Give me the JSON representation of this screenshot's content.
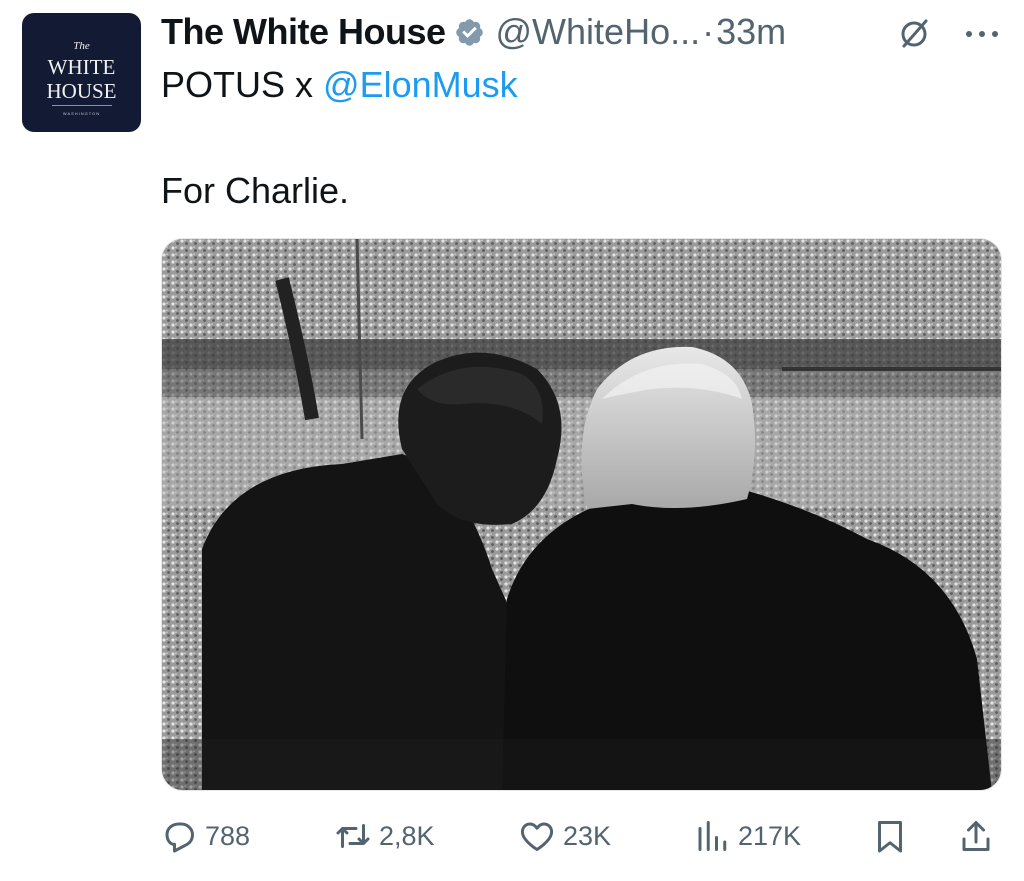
{
  "account": {
    "display_name": "The White House",
    "handle": "@WhiteHo...",
    "separator": "·",
    "timestamp": "33m",
    "verified_icon": "verified-badge-icon",
    "avatar_text": {
      "the": "The",
      "line1": "WHITE",
      "line2": "HOUSE",
      "sub": "WASHINGTON"
    }
  },
  "post": {
    "context_prefix": "POTUS x ",
    "context_mention": "@ElonMusk",
    "text": "For Charlie."
  },
  "actions": {
    "replies": "788",
    "reposts": "2,8K",
    "likes": "23K",
    "views": "217K"
  },
  "icons": {
    "grok": "grok-icon",
    "more": "more-icon",
    "reply": "reply-icon",
    "repost": "repost-icon",
    "like": "heart-icon",
    "views": "analytics-icon",
    "bookmark": "bookmark-icon",
    "share": "share-icon"
  },
  "colors": {
    "text": "#0f1419",
    "secondary": "#536471",
    "link": "#1d9bf0",
    "avatar_bg": "#131a34"
  }
}
